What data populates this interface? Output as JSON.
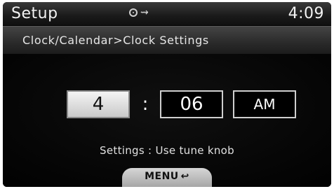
{
  "status_bar": {
    "title": "Setup",
    "clock": "4:09",
    "icons": [
      "disc-icon",
      "usb-icon"
    ]
  },
  "breadcrumb": "Clock/Calendar>Clock Settings",
  "time": {
    "hour": "4",
    "separator": ":",
    "minute": "06",
    "period": "AM"
  },
  "hint": "Settings : Use tune knob",
  "menu": {
    "label": "MENU",
    "icon": "return-icon"
  },
  "colors": {
    "background": "#000000",
    "selected_field": "#e6e6e6",
    "text": "#ffffff"
  }
}
